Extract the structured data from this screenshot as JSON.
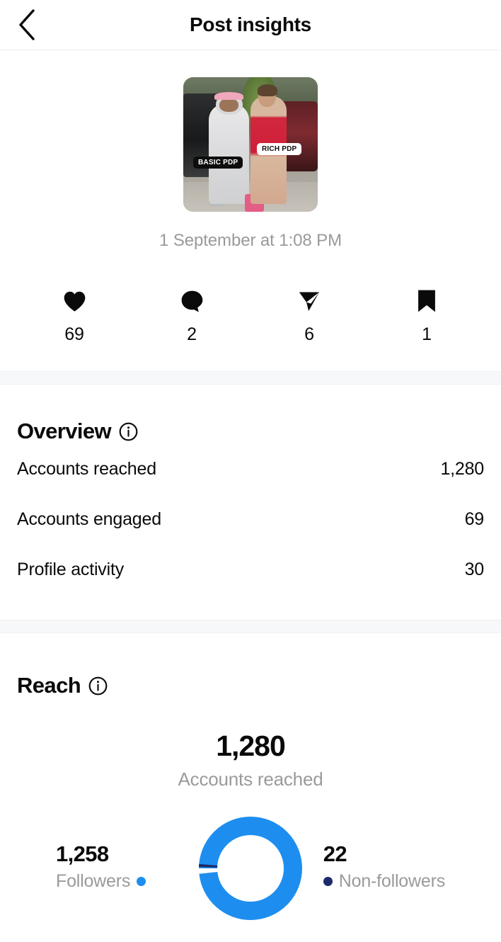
{
  "header": {
    "back_icon": "chevron-left-icon",
    "title": "Post insights"
  },
  "post": {
    "thumbnail": {
      "alt": "Couple walking on street meme",
      "tag_left": "BASIC PDP",
      "tag_right": "RICH PDP"
    },
    "date": "1 September at 1:08 PM",
    "stats": [
      {
        "icon": "heart-icon",
        "name": "likes",
        "value": "69"
      },
      {
        "icon": "comment-icon",
        "name": "comments",
        "value": "2"
      },
      {
        "icon": "share-icon",
        "name": "shares",
        "value": "6"
      },
      {
        "icon": "bookmark-icon",
        "name": "saves",
        "value": "1"
      }
    ]
  },
  "overview": {
    "title": "Overview",
    "info_icon": "info-circle-icon",
    "rows": [
      {
        "label": "Accounts reached",
        "value": "1,280"
      },
      {
        "label": "Accounts engaged",
        "value": "69"
      },
      {
        "label": "Profile activity",
        "value": "30"
      }
    ]
  },
  "reach": {
    "title": "Reach",
    "info_icon": "info-circle-icon",
    "total_value": "1,280",
    "total_label": "Accounts reached",
    "chart_data": {
      "type": "pie",
      "title": "Accounts reached",
      "categories": [
        "Followers",
        "Non-followers"
      ],
      "values": [
        1258,
        22
      ],
      "colors": [
        "#1d8ef0",
        "#1b2a6b"
      ],
      "total": 1280,
      "legend": "sides"
    },
    "segments": [
      {
        "value": "1,258",
        "label": "Followers",
        "color": "#1d8ef0"
      },
      {
        "value": "22",
        "label": "Non-followers",
        "color": "#1b2a6b"
      }
    ]
  }
}
